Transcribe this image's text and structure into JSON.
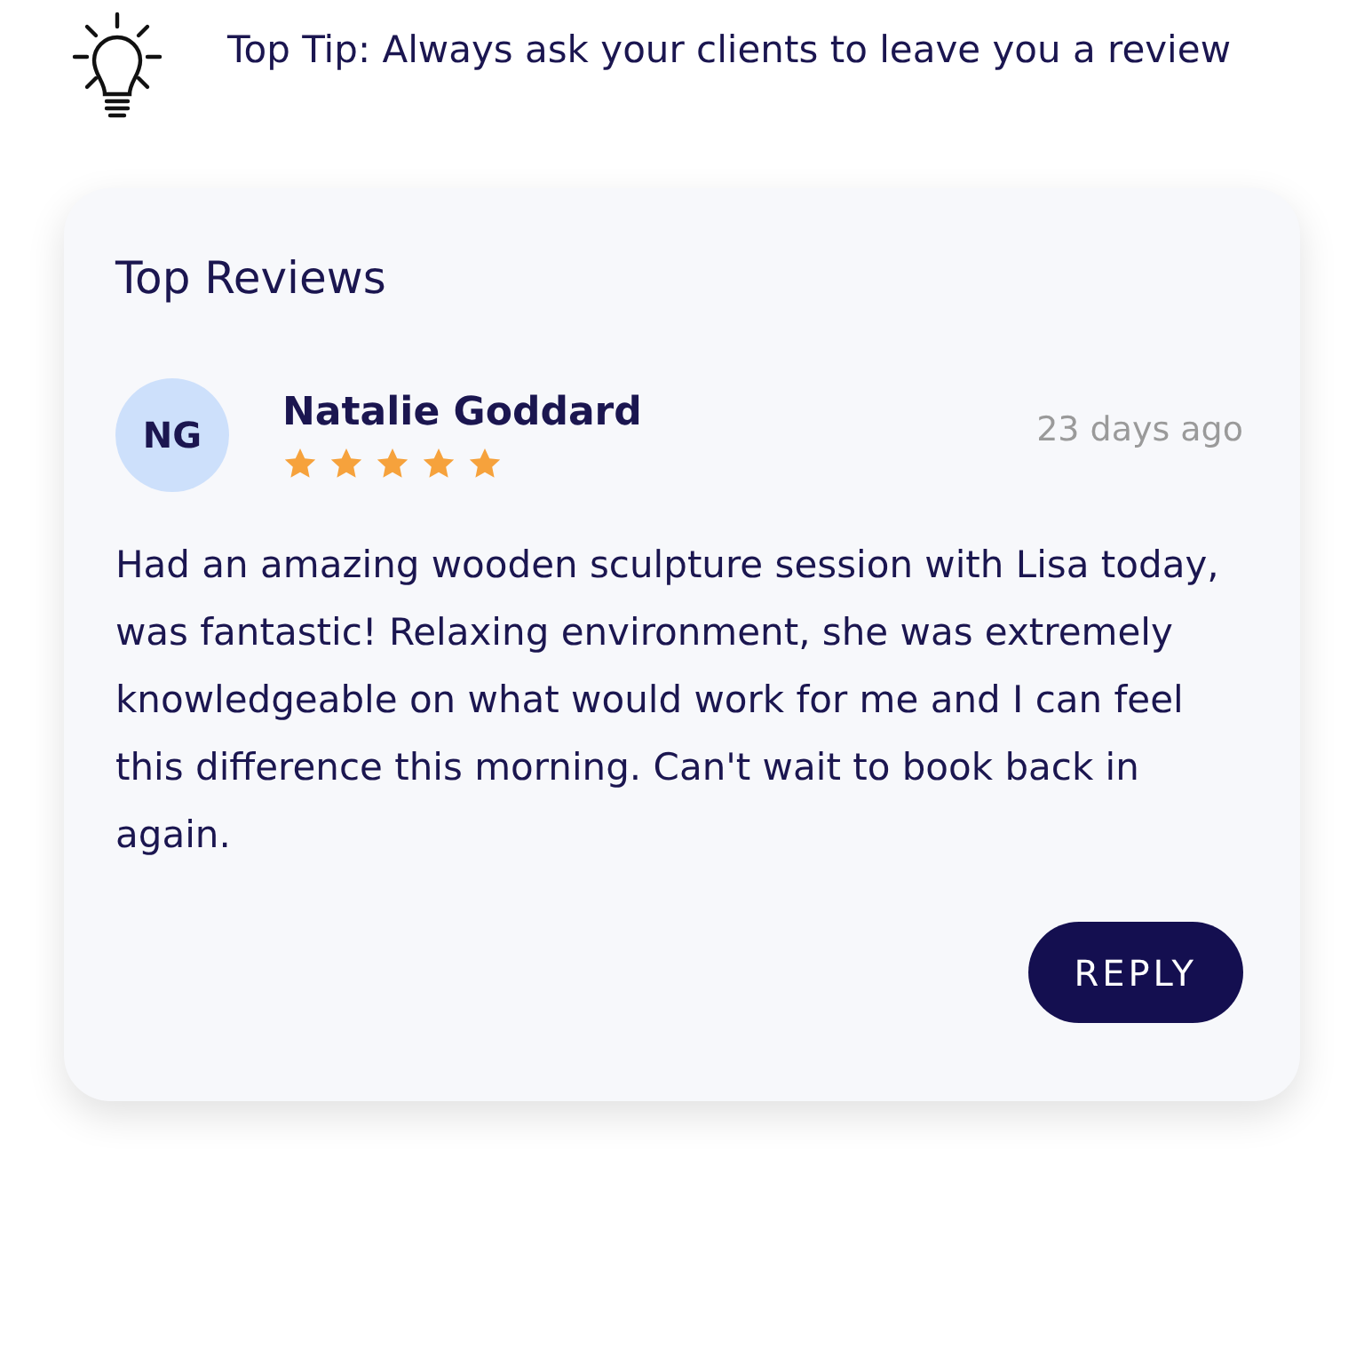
{
  "tip": {
    "text": "Top Tip: Always ask your clients to leave you a review"
  },
  "reviews_card": {
    "title": "Top Reviews",
    "review": {
      "initials": "NG",
      "name": "Natalie Goddard",
      "stars": 5,
      "time": "23 days ago",
      "body": "Had an amazing wooden sculpture session with Lisa today, was fantastic! Relaxing environment, she was extremely knowledgeable on what would work for me and I can feel this difference this morning. Can't wait to book back in again."
    },
    "reply_button": "REPLY"
  }
}
